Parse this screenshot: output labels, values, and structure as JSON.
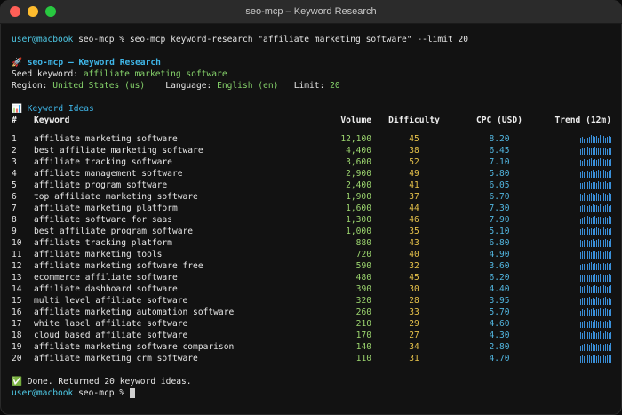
{
  "window": {
    "title": "seo-mcp – Keyword Research"
  },
  "prompt": {
    "user": "user@macbook",
    "dir": "seo-mcp",
    "symbol": "%"
  },
  "command": "seo-mcp keyword-research \"affiliate marketing software\" --limit 20",
  "header": {
    "emoji": "🚀",
    "title": "seo-mcp – Keyword Research",
    "seed_label": "Seed keyword:",
    "seed_value": "affiliate marketing software",
    "region_label": "Region:",
    "region_value": "United States (us)",
    "language_label": "Language:",
    "language_value": "English (en)",
    "limit_label": "Limit:",
    "limit_value": "20"
  },
  "section": {
    "emoji": "📊",
    "title": "Keyword Ideas"
  },
  "table": {
    "columns": [
      "#",
      "Keyword",
      "Volume",
      "Difficulty",
      "CPC (USD)",
      "Trend (12m)"
    ],
    "rows": [
      {
        "n": "1",
        "kw": "affiliate marketing software",
        "vol": "12,100",
        "diff": "45",
        "cpc": "8.20",
        "trend": [
          6,
          7,
          5,
          8,
          6,
          7,
          9,
          8,
          7,
          8,
          6,
          9,
          7,
          8,
          6,
          7,
          8,
          7
        ]
      },
      {
        "n": "2",
        "kw": "best affiliate marketing software",
        "vol": "4,400",
        "diff": "38",
        "cpc": "6.45",
        "trend": [
          5,
          6,
          7,
          5,
          8,
          6,
          7,
          6,
          8,
          7,
          6,
          7,
          8,
          6,
          7,
          5,
          7,
          6
        ]
      },
      {
        "n": "3",
        "kw": "affiliate tracking software",
        "vol": "3,600",
        "diff": "52",
        "cpc": "7.10",
        "trend": [
          6,
          5,
          7,
          6,
          6,
          7,
          8,
          6,
          7,
          6,
          7,
          8,
          6,
          7,
          6,
          7,
          6,
          7
        ]
      },
      {
        "n": "4",
        "kw": "affiliate management software",
        "vol": "2,900",
        "diff": "49",
        "cpc": "5.80",
        "trend": [
          5,
          7,
          6,
          8,
          7,
          6,
          7,
          8,
          6,
          7,
          8,
          7,
          6,
          8,
          7,
          6,
          7,
          8
        ]
      },
      {
        "n": "5",
        "kw": "affiliate program software",
        "vol": "2,400",
        "diff": "41",
        "cpc": "6.05",
        "trend": [
          6,
          6,
          7,
          5,
          7,
          8,
          6,
          7,
          7,
          6,
          8,
          7,
          6,
          7,
          8,
          6,
          7,
          7
        ]
      },
      {
        "n": "6",
        "kw": "top affiliate marketing software",
        "vol": "1,900",
        "diff": "37",
        "cpc": "6.70",
        "trend": [
          7,
          6,
          8,
          7,
          6,
          7,
          8,
          7,
          6,
          8,
          7,
          6,
          7,
          8,
          7,
          6,
          8,
          7
        ]
      },
      {
        "n": "7",
        "kw": "affiliate marketing platform",
        "vol": "1,600",
        "diff": "44",
        "cpc": "7.30",
        "trend": [
          6,
          7,
          7,
          8,
          6,
          7,
          6,
          8,
          7,
          7,
          6,
          8,
          7,
          6,
          7,
          8,
          6,
          7
        ]
      },
      {
        "n": "8",
        "kw": "affiliate software for saas",
        "vol": "1,300",
        "diff": "46",
        "cpc": "7.90",
        "trend": [
          5,
          6,
          7,
          6,
          8,
          7,
          6,
          7,
          8,
          6,
          7,
          7,
          8,
          6,
          7,
          6,
          8,
          7
        ]
      },
      {
        "n": "9",
        "kw": "best affiliate program software",
        "vol": "1,000",
        "diff": "35",
        "cpc": "5.10",
        "trend": [
          6,
          7,
          6,
          7,
          8,
          6,
          7,
          6,
          7,
          8,
          7,
          6,
          7,
          8,
          6,
          7,
          6,
          7
        ]
      },
      {
        "n": "10",
        "kw": "affiliate tracking platform",
        "vol": "880",
        "diff": "43",
        "cpc": "6.80",
        "trend": [
          7,
          6,
          7,
          8,
          7,
          6,
          7,
          8,
          6,
          7,
          8,
          7,
          6,
          7,
          8,
          7,
          6,
          8
        ]
      },
      {
        "n": "11",
        "kw": "affiliate marketing tools",
        "vol": "720",
        "diff": "40",
        "cpc": "4.90",
        "trend": [
          6,
          7,
          8,
          6,
          7,
          7,
          6,
          8,
          7,
          6,
          7,
          8,
          7,
          6,
          7,
          8,
          6,
          7
        ]
      },
      {
        "n": "12",
        "kw": "affiliate marketing software free",
        "vol": "590",
        "diff": "32",
        "cpc": "3.60",
        "trend": [
          5,
          6,
          6,
          7,
          6,
          7,
          8,
          6,
          7,
          6,
          7,
          6,
          8,
          7,
          6,
          7,
          6,
          7
        ]
      },
      {
        "n": "13",
        "kw": "ecommerce affiliate software",
        "vol": "480",
        "diff": "45",
        "cpc": "6.20",
        "trend": [
          6,
          7,
          6,
          8,
          7,
          6,
          7,
          7,
          8,
          6,
          7,
          8,
          6,
          7,
          7,
          6,
          8,
          7
        ]
      },
      {
        "n": "14",
        "kw": "affiliate dashboard software",
        "vol": "390",
        "diff": "30",
        "cpc": "4.40",
        "trend": [
          7,
          6,
          7,
          6,
          8,
          7,
          6,
          7,
          8,
          7,
          6,
          7,
          6,
          8,
          7,
          6,
          7,
          8
        ]
      },
      {
        "n": "15",
        "kw": "multi level affiliate software",
        "vol": "320",
        "diff": "28",
        "cpc": "3.95",
        "trend": [
          6,
          7,
          7,
          6,
          7,
          8,
          6,
          7,
          6,
          8,
          7,
          6,
          7,
          7,
          8,
          6,
          7,
          6
        ]
      },
      {
        "n": "16",
        "kw": "affiliate marketing automation software",
        "vol": "260",
        "diff": "33",
        "cpc": "5.70",
        "trend": [
          5,
          7,
          6,
          7,
          8,
          6,
          7,
          8,
          6,
          7,
          7,
          8,
          6,
          7,
          8,
          7,
          6,
          7
        ]
      },
      {
        "n": "17",
        "kw": "white label affiliate software",
        "vol": "210",
        "diff": "29",
        "cpc": "4.60",
        "trend": [
          6,
          6,
          7,
          8,
          6,
          7,
          7,
          6,
          8,
          7,
          6,
          7,
          8,
          6,
          7,
          6,
          8,
          7
        ]
      },
      {
        "n": "18",
        "kw": "cloud based affiliate software",
        "vol": "170",
        "diff": "27",
        "cpc": "4.30",
        "trend": [
          7,
          6,
          8,
          6,
          7,
          7,
          6,
          8,
          7,
          6,
          7,
          8,
          7,
          6,
          8,
          7,
          6,
          7
        ]
      },
      {
        "n": "19",
        "kw": "affiliate marketing software comparison",
        "vol": "140",
        "diff": "34",
        "cpc": "2.80",
        "trend": [
          5,
          6,
          7,
          6,
          7,
          6,
          8,
          7,
          6,
          7,
          6,
          7,
          8,
          6,
          7,
          7,
          6,
          8
        ]
      },
      {
        "n": "20",
        "kw": "affiliate marketing crm software",
        "vol": "110",
        "diff": "31",
        "cpc": "4.70",
        "trend": [
          6,
          7,
          6,
          7,
          8,
          7,
          6,
          8,
          7,
          6,
          7,
          6,
          8,
          7,
          6,
          7,
          8,
          7
        ]
      }
    ]
  },
  "footer": {
    "done_emoji": "✅",
    "done_text": "Done. Returned 20 keyword ideas."
  },
  "colors": {
    "user": "#4ec9e6",
    "green": "#86d36b",
    "cyan": "#3fb6e8",
    "yellow": "#e6c24a",
    "spark": "#3a8fd8"
  }
}
